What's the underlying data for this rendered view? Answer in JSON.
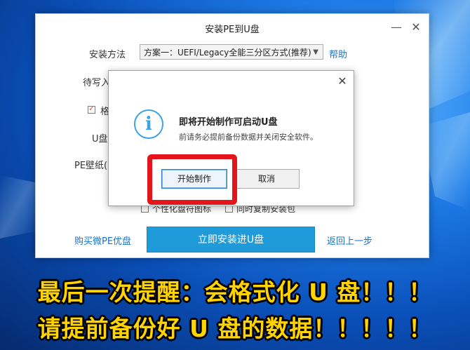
{
  "window": {
    "title": "安装PE到U盘",
    "minimize_glyph": "—",
    "close_glyph": "✕"
  },
  "form": {
    "install_method_label": "安装方法",
    "install_method_value": "方案一：UEFI/Legacy全能三分区方式(推荐)",
    "help_link": "帮助",
    "target_label": "待写入",
    "format_label": "格",
    "udisk_label": "U盘",
    "wallpaper_label": "PE壁纸(可",
    "option_personal_label": "个性化盘符图标",
    "option_copy_label": "同时复制安装包",
    "buy_link": "购买微PE优盘",
    "install_button": "立即安装进U盘",
    "back_link": "返回上一步"
  },
  "popup": {
    "close_glyph": "✕",
    "icon": "info-icon",
    "icon_glyph": "i",
    "title": "即将开始制作可启动U盘",
    "message": "前请务必提前备份数据并关闭安全软件。",
    "start_button": "开始制作",
    "cancel_button": "取消"
  },
  "captions": {
    "line1": "最后一次提醒：会格式化 U 盘！！！",
    "line2": "请提前备份好 U 盘的数据！！！！！"
  },
  "colors": {
    "accent_blue": "#1f9bd9",
    "link_blue": "#1a73c8",
    "highlight_red": "#e3141a",
    "caption_yellow": "#ffd400"
  }
}
